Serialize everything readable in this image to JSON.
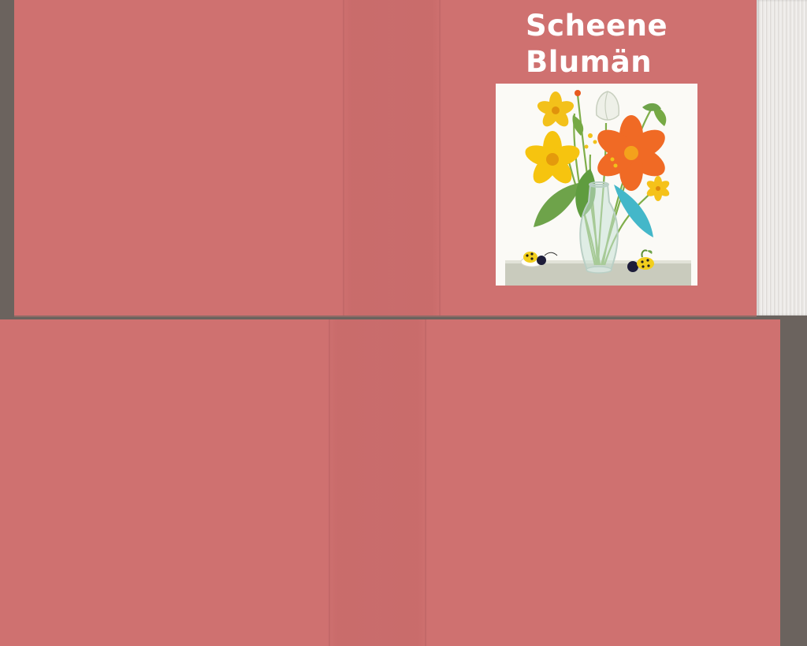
{
  "cover": {
    "title_line_1": "Scheene",
    "title_line_2": "Blumän"
  },
  "colors": {
    "cover": "#cf7170",
    "background": "#6b635e",
    "title_text": "#ffffff",
    "pages": "#f1efed"
  },
  "illustration": {
    "subject": "flowers-in-glass-vase-with-ladybugs"
  }
}
